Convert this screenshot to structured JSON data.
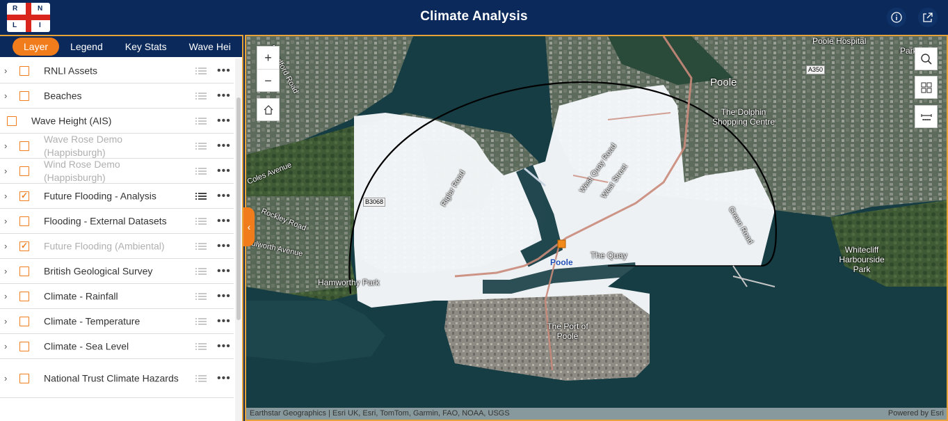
{
  "header": {
    "title": "Climate Analysis",
    "logo_letters": [
      "R",
      "N",
      "L",
      "I"
    ],
    "info_icon": "info-icon",
    "share_icon": "share-icon"
  },
  "sidebar": {
    "tabs": [
      {
        "label": "Layer",
        "active": true
      },
      {
        "label": "Legend",
        "active": false
      },
      {
        "label": "Key Stats",
        "active": false
      },
      {
        "label": "Wave Hei",
        "active": false
      }
    ],
    "layers": [
      {
        "label": "RNLI Assets",
        "checked": false,
        "dim": false,
        "expandable": true
      },
      {
        "label": "Beaches",
        "checked": false,
        "dim": false,
        "expandable": true
      },
      {
        "label": "Wave Height (AIS)",
        "checked": false,
        "dim": false,
        "expandable": false
      },
      {
        "label": "Wave Rose Demo (Happisburgh)",
        "checked": false,
        "dim": true,
        "expandable": true
      },
      {
        "label": "Wind Rose Demo (Happisburgh)",
        "checked": false,
        "dim": true,
        "expandable": true
      },
      {
        "label": "Future Flooding - Analysis",
        "checked": true,
        "dim": false,
        "expandable": true
      },
      {
        "label": "Flooding - External Datasets",
        "checked": false,
        "dim": false,
        "expandable": true
      },
      {
        "label": "Future Flooding (Ambiental)",
        "checked": true,
        "dim": true,
        "expandable": true
      },
      {
        "label": "British Geological Survey",
        "checked": false,
        "dim": false,
        "expandable": true
      },
      {
        "label": "Climate - Rainfall",
        "checked": false,
        "dim": false,
        "expandable": true
      },
      {
        "label": "Climate - Temperature",
        "checked": false,
        "dim": false,
        "expandable": true
      },
      {
        "label": "Climate - Sea Level",
        "checked": false,
        "dim": false,
        "expandable": true
      },
      {
        "label": "National Trust Climate Hazards",
        "checked": false,
        "dim": false,
        "expandable": true
      }
    ],
    "checkmark": "✓"
  },
  "map": {
    "zoom_in": "+",
    "zoom_out": "−",
    "labels": {
      "poole": "Poole",
      "poole_hospital": "Poole Hospital",
      "parkstone": "Parkstone",
      "dolphin": "The Dolphin Shopping Centre",
      "west_quay": "West Quay Road",
      "west_street": "West Street",
      "green_road": "Green Road",
      "rigler": "Rigler Road",
      "coles": "Coles Avenue",
      "rockley": "Rockley Road",
      "hulworth": "Hulworth Avenue",
      "hamworthy": "Hamworthy Park",
      "the_quay": "The Quay",
      "poole_blue": "Poole",
      "whitecliff": "Whitecliff Harbourside Park",
      "port": "The Port of Poole",
      "blandford": "Blandford Road",
      "b3068": "B3068",
      "a350": "A350"
    },
    "attribution": "Earthstar Geographics | Esri UK, Esri, TomTom, Garmin, FAO, NOAA, USGS",
    "powered": "Powered by Esri"
  }
}
